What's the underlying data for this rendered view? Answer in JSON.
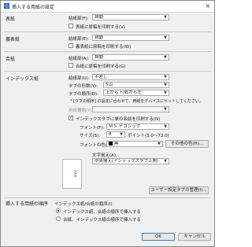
{
  "window": {
    "title": "挿入する用紙の設定",
    "close_glyph": "×"
  },
  "section_cover": {
    "title": "表紙",
    "source_label": "給紙部(F):",
    "source_value": "自動",
    "print_checkbox_label": "表紙に原稿を印刷する(V)",
    "print_checked": false
  },
  "section_back": {
    "title": "裏表紙",
    "source_label": "給紙部(E):",
    "source_value": "自動",
    "print_checkbox_label": "裏表紙に原稿を印刷する(W)",
    "print_checked": false
  },
  "section_insert": {
    "title": "合紙",
    "source_label": "給紙部(A):",
    "source_value": "自動",
    "print_checkbox_label": "合紙に原稿を印刷する(G)",
    "print_checked": false
  },
  "section_index": {
    "title": "インデックス紙",
    "source_label": "給紙部(U):",
    "source_value": "手差し",
    "tab_count_label": "タブの形数(Y):",
    "tab_count_value": "5山",
    "tab_order_label": "タブの順序(D):",
    "tab_order_value": "上から下/右から左",
    "note": "* [タブの順序] の設定に合わせて、用紙をデバイスにセットしてください。",
    "paper_type_label": "用紙種類(Y):",
    "paper_type_value": "",
    "print_checkbox_label": "インデックスタブに単の名前を印刷する(N)",
    "print_checked": true,
    "font_label": "フォント(F):",
    "font_value": "ＭＳ Ｐゴシック",
    "size_label": "サイズ(S):",
    "size_value": "8",
    "size_unit": "ポイント(3.0〜72.0)",
    "color_label": "フォントの色(C):",
    "color_value": "黒",
    "color_hex": "#000000",
    "other_font_button": "その他の色(H)...",
    "text_dir_label": "文字揃え(A):",
    "text_dir_value": "中央揃え(インデックスタブ上側)",
    "preview_text": "AAA",
    "user_tab_button": "ユーザー設定タブの管理(I)..."
  },
  "section_order": {
    "title": "挿入する用紙の順序",
    "group_label": "インデックス紙/合紙の順序(I)",
    "options": [
      {
        "label": "インデックス紙、合紙の順序で挿入する",
        "selected": true
      },
      {
        "label": "合紙、インデックス紙の順序で挿入する",
        "selected": false
      }
    ]
  },
  "footer": {
    "ok_label": "OK",
    "cancel_label": "キャンセル"
  }
}
